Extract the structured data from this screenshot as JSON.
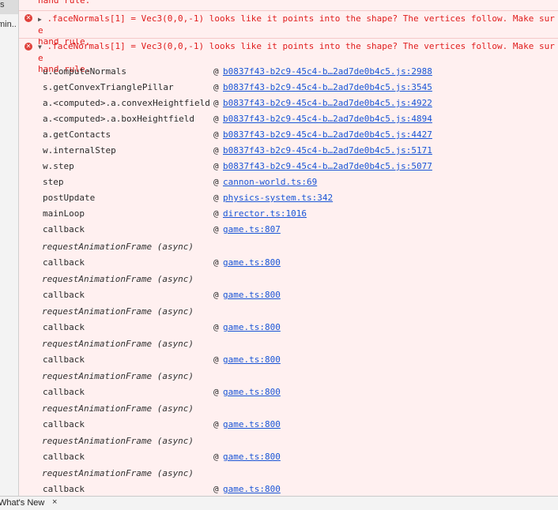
{
  "sidebar": {
    "items": [
      "s",
      "min..."
    ]
  },
  "console": {
    "messages": [
      {
        "expanded": false,
        "text": ".faceNormals[1] = Vec3(0,0,-1) looks like it points into the shape? The vertices follow. Make sure they are ordered CCW around the normal, using the right hand rule.",
        "visible_line1": ".faceNormals[1] = Vec3(0,0,-1) looks like it points into the shape? The vertices follow. Make sure",
        "visible_line2": "hand rule."
      },
      {
        "expanded": true,
        "text": ".faceNormals[1] = Vec3(0,0,-1) looks like it points into the shape? The vertices follow. Make sure they are ordered CCW around the normal, using the right hand rule.",
        "visible_line1": ".faceNormals[1] = Vec3(0,0,-1) looks like it points into the shape? The vertices follow. Make sure",
        "visible_line2": "hand rule."
      }
    ],
    "stack": [
      {
        "fn": "u.computeNormals",
        "loc": "b0837f43-b2c9-45c4-b…2ad7de0b4c5.js:2988"
      },
      {
        "fn": "s.getConvexTrianglePillar",
        "loc": "b0837f43-b2c9-45c4-b…2ad7de0b4c5.js:3545"
      },
      {
        "fn": "a.<computed>.a.convexHeightfield",
        "loc": "b0837f43-b2c9-45c4-b…2ad7de0b4c5.js:4922"
      },
      {
        "fn": "a.<computed>.a.boxHeightfield",
        "loc": "b0837f43-b2c9-45c4-b…2ad7de0b4c5.js:4894"
      },
      {
        "fn": "a.getContacts",
        "loc": "b0837f43-b2c9-45c4-b…2ad7de0b4c5.js:4427"
      },
      {
        "fn": "w.internalStep",
        "loc": "b0837f43-b2c9-45c4-b…2ad7de0b4c5.js:5171"
      },
      {
        "fn": "w.step",
        "loc": "b0837f43-b2c9-45c4-b…2ad7de0b4c5.js:5077"
      },
      {
        "fn": "step",
        "loc": "cannon-world.ts:69"
      },
      {
        "fn": "postUpdate",
        "loc": "physics-system.ts:342"
      },
      {
        "fn": "mainLoop",
        "loc": "director.ts:1016"
      },
      {
        "fn": "callback",
        "loc": "game.ts:807"
      },
      {
        "async": "requestAnimationFrame (async)"
      },
      {
        "fn": "callback",
        "loc": "game.ts:800"
      },
      {
        "async": "requestAnimationFrame (async)"
      },
      {
        "fn": "callback",
        "loc": "game.ts:800"
      },
      {
        "async": "requestAnimationFrame (async)"
      },
      {
        "fn": "callback",
        "loc": "game.ts:800"
      },
      {
        "async": "requestAnimationFrame (async)"
      },
      {
        "fn": "callback",
        "loc": "game.ts:800"
      },
      {
        "async": "requestAnimationFrame (async)"
      },
      {
        "fn": "callback",
        "loc": "game.ts:800"
      },
      {
        "async": "requestAnimationFrame (async)"
      },
      {
        "fn": "callback",
        "loc": "game.ts:800"
      },
      {
        "async": "requestAnimationFrame (async)"
      },
      {
        "fn": "callback",
        "loc": "game.ts:800"
      },
      {
        "async": "requestAnimationFrame (async)"
      },
      {
        "fn": "callback",
        "loc": "game.ts:800"
      }
    ],
    "at_symbol": "@"
  },
  "drawer": {
    "tab_label": "What's New",
    "close_glyph": "×"
  },
  "colors": {
    "error_text": "#e01c1c",
    "error_background": "#fff0f0",
    "link": "#1a55d6"
  }
}
